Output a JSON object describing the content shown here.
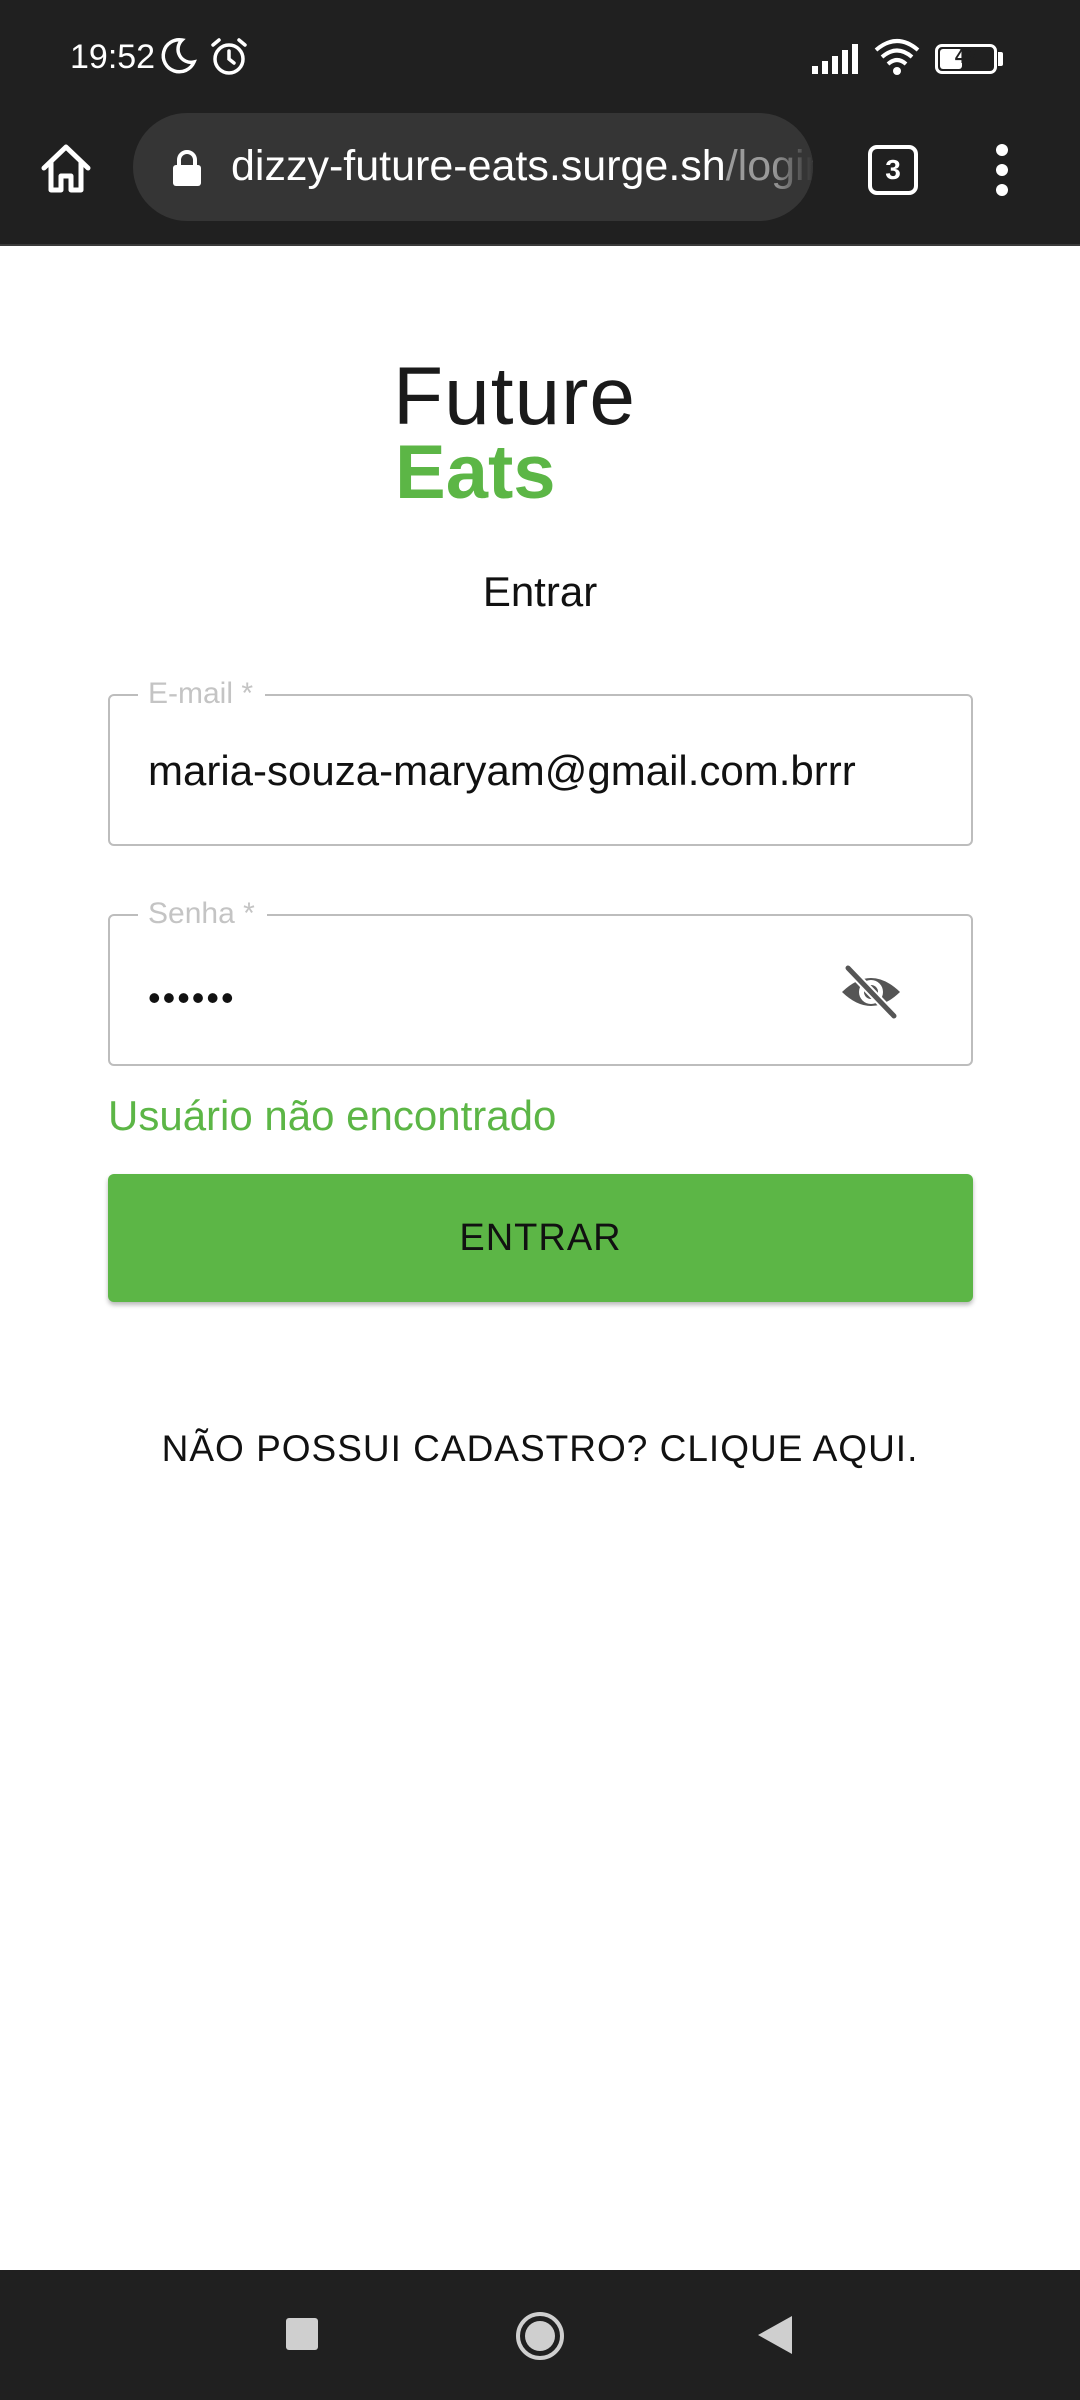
{
  "status_bar": {
    "time": "19:52",
    "battery": "46",
    "battery_level": 0.46,
    "icons": [
      "moon-icon",
      "alarm-icon",
      "signal-icon",
      "wifi-icon",
      "battery-icon"
    ]
  },
  "browser": {
    "url_host": "dizzy-future-eats.surge.sh",
    "url_path": "/login",
    "tab_count": "3",
    "icons": [
      "home-icon",
      "lock-icon",
      "tabs-icon",
      "menu-icon"
    ]
  },
  "logo": {
    "line1": "Future",
    "line2": "Eats",
    "accent_color": "#5cb646"
  },
  "login": {
    "title": "Entrar",
    "email": {
      "label": "E-mail *",
      "value": "maria-souza-maryam@gmail.com.brrr"
    },
    "password": {
      "label": "Senha *",
      "masked_value": "••••••"
    },
    "error": "Usuário não encontrado",
    "submit_label": "ENTRAR",
    "signup_label": "NÃO POSSUI CADASTRO? CLIQUE AQUI."
  },
  "nav_bar": {
    "icons": [
      "recents-icon",
      "home-circle-icon",
      "back-icon"
    ]
  }
}
